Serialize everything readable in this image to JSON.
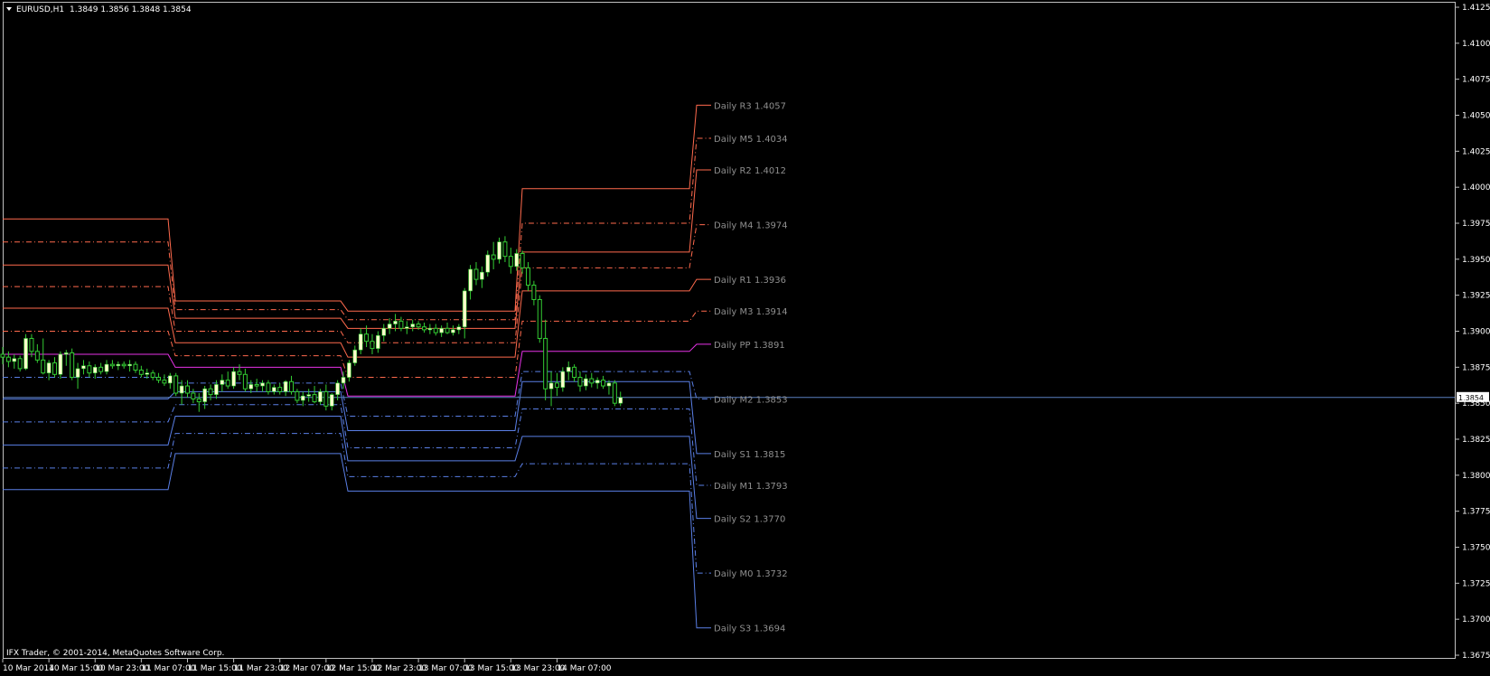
{
  "header": {
    "symbol": "EURUSD,H1",
    "ohlc": "1.3849 1.3856 1.3848 1.3854"
  },
  "footer": {
    "copyright": "IFX Trader, © 2001-2014, MetaQuotes Software Corp."
  },
  "colors": {
    "background": "#000000",
    "frame": "#c0c0c0",
    "resistance": "#ff6a4d",
    "pivot": "#e632e6",
    "support": "#5a7fe6",
    "bull_body": "#ffffcc",
    "wick": "#33cc33",
    "current_line": "#5a7fbf",
    "label_text": "#8f8f8f"
  },
  "chart_data": {
    "type": "candlestick",
    "symbol": "EURUSD",
    "timeframe": "H1",
    "ylim": [
      1.3675,
      1.4125
    ],
    "y_ticks": [
      "1.4125",
      "1.4100",
      "1.4075",
      "1.4050",
      "1.4025",
      "1.4000",
      "1.3975",
      "1.3950",
      "1.3925",
      "1.3900",
      "1.3875",
      "1.3850",
      "1.3825",
      "1.3800",
      "1.3775",
      "1.3750",
      "1.3725",
      "1.3700",
      "1.3675"
    ],
    "x_ticks": [
      "10 Mar 2014",
      "10 Mar 15:00",
      "10 Mar 23:00",
      "11 Mar 07:00",
      "11 Mar 15:00",
      "11 Mar 23:00",
      "12 Mar 07:00",
      "12 Mar 15:00",
      "12 Mar 23:00",
      "13 Mar 07:00",
      "13 Mar 15:00",
      "13 Mar 23:00",
      "14 Mar 07:00"
    ],
    "current_price": "1.3854",
    "day_starts": [
      "11 Mar 00:00",
      "12 Mar 00:00",
      "13 Mar 00:00",
      "14 Mar 00:00"
    ],
    "levels": [
      {
        "name": "R3",
        "role": "resistance",
        "style": "solid",
        "values": [
          1.3978,
          1.3921,
          1.3914,
          1.3999,
          1.4057
        ]
      },
      {
        "name": "M5",
        "role": "resistance",
        "style": "dashdot",
        "values": [
          1.3962,
          1.3915,
          1.3908,
          1.3975,
          1.4034
        ]
      },
      {
        "name": "R2",
        "role": "resistance",
        "style": "solid",
        "values": [
          1.3946,
          1.3909,
          1.3902,
          1.3955,
          1.4012
        ]
      },
      {
        "name": "M4",
        "role": "resistance",
        "style": "dashdot",
        "values": [
          1.3931,
          1.39,
          1.3892,
          1.3944,
          1.3974
        ]
      },
      {
        "name": "R1",
        "role": "resistance",
        "style": "solid",
        "values": [
          1.3916,
          1.3892,
          1.3882,
          1.3928,
          1.3936
        ]
      },
      {
        "name": "M3",
        "role": "resistance",
        "style": "dashdot",
        "values": [
          1.39,
          1.3883,
          1.3868,
          1.3907,
          1.3914
        ]
      },
      {
        "name": "PP",
        "role": "pivot",
        "style": "solid",
        "values": [
          1.3884,
          1.3875,
          1.3855,
          1.3886,
          1.3891
        ]
      },
      {
        "name": "M2",
        "role": "support",
        "style": "dashdot",
        "values": [
          1.3868,
          1.3864,
          1.3841,
          1.3872,
          1.3853
        ]
      },
      {
        "name": "S1",
        "role": "support",
        "style": "solid",
        "values": [
          1.3853,
          1.3858,
          1.3831,
          1.3865,
          1.3815
        ]
      },
      {
        "name": "M1",
        "role": "support",
        "style": "dashdot",
        "values": [
          1.3837,
          1.3849,
          1.3819,
          1.3846,
          1.3793
        ]
      },
      {
        "name": "S2",
        "role": "support",
        "style": "solid",
        "values": [
          1.3821,
          1.3841,
          1.381,
          1.3827,
          1.377
        ]
      },
      {
        "name": "M0",
        "role": "support",
        "style": "dashdot",
        "values": [
          1.3805,
          1.3829,
          1.3799,
          1.3808,
          1.3732
        ]
      },
      {
        "name": "S3",
        "role": "support",
        "style": "solid",
        "values": [
          1.379,
          1.3815,
          1.3789,
          1.3789,
          1.3694
        ]
      }
    ],
    "level_labels": [
      {
        "text": "Daily R3 1.4057",
        "price": 1.4057
      },
      {
        "text": "Daily M5 1.4034",
        "price": 1.4034
      },
      {
        "text": "Daily R2 1.4012",
        "price": 1.4012
      },
      {
        "text": "Daily M4 1.3974",
        "price": 1.3974
      },
      {
        "text": "Daily R1 1.3936",
        "price": 1.3936
      },
      {
        "text": "Daily M3 1.3914",
        "price": 1.3914
      },
      {
        "text": "Daily PP 1.3891",
        "price": 1.3891
      },
      {
        "text": "Daily M2 1.3853",
        "price": 1.3853
      },
      {
        "text": "Daily S1 1.3815",
        "price": 1.3815
      },
      {
        "text": "Daily M1 1.3793",
        "price": 1.3793
      },
      {
        "text": "Daily S2 1.3770",
        "price": 1.377
      },
      {
        "text": "Daily M0 1.3732",
        "price": 1.3732
      },
      {
        "text": "Daily S3 1.3694",
        "price": 1.3694
      }
    ],
    "bar_interval": "1 hour",
    "candles_ohlc": [
      [
        1.3884,
        1.3889,
        1.3877,
        1.3882
      ],
      [
        1.3882,
        1.3886,
        1.3875,
        1.3879
      ],
      [
        1.3879,
        1.3884,
        1.3874,
        1.3881
      ],
      [
        1.3881,
        1.3883,
        1.3872,
        1.3874
      ],
      [
        1.3874,
        1.3898,
        1.3873,
        1.3895
      ],
      [
        1.3895,
        1.3898,
        1.3882,
        1.3886
      ],
      [
        1.3886,
        1.3891,
        1.3878,
        1.388
      ],
      [
        1.388,
        1.3895,
        1.387,
        1.3871
      ],
      [
        1.3871,
        1.388,
        1.3866,
        1.3878
      ],
      [
        1.3878,
        1.3882,
        1.3868,
        1.387
      ],
      [
        1.387,
        1.3886,
        1.3867,
        1.3884
      ],
      [
        1.3884,
        1.3887,
        1.3876,
        1.3885
      ],
      [
        1.3885,
        1.3888,
        1.3866,
        1.3868
      ],
      [
        1.3868,
        1.3878,
        1.386,
        1.3874
      ],
      [
        1.3874,
        1.388,
        1.387,
        1.3876
      ],
      [
        1.3876,
        1.3879,
        1.3868,
        1.3871
      ],
      [
        1.3871,
        1.3877,
        1.3867,
        1.3875
      ],
      [
        1.3875,
        1.3878,
        1.387,
        1.3872
      ],
      [
        1.3872,
        1.388,
        1.387,
        1.3877
      ],
      [
        1.3877,
        1.388,
        1.3874,
        1.3876
      ],
      [
        1.3876,
        1.3879,
        1.3873,
        1.3877
      ],
      [
        1.3877,
        1.3879,
        1.3874,
        1.3876
      ],
      [
        1.3876,
        1.388,
        1.3872,
        1.3877
      ],
      [
        1.3877,
        1.3879,
        1.3871,
        1.3873
      ],
      [
        1.3873,
        1.3876,
        1.3868,
        1.387
      ],
      [
        1.387,
        1.3874,
        1.3867,
        1.3871
      ],
      [
        1.3871,
        1.3873,
        1.3866,
        1.3868
      ],
      [
        1.3868,
        1.3871,
        1.3864,
        1.3866
      ],
      [
        1.3866,
        1.387,
        1.3862,
        1.3864
      ],
      [
        1.3864,
        1.3871,
        1.386,
        1.3869
      ],
      [
        1.3869,
        1.3871,
        1.3855,
        1.3857
      ],
      [
        1.3857,
        1.3866,
        1.3849,
        1.3862
      ],
      [
        1.3862,
        1.3866,
        1.3854,
        1.3857
      ],
      [
        1.3857,
        1.386,
        1.385,
        1.3853
      ],
      [
        1.3853,
        1.3857,
        1.3844,
        1.3851
      ],
      [
        1.3851,
        1.3862,
        1.3846,
        1.386
      ],
      [
        1.386,
        1.3863,
        1.3852,
        1.3856
      ],
      [
        1.3856,
        1.3866,
        1.3853,
        1.3863
      ],
      [
        1.3863,
        1.387,
        1.3858,
        1.3866
      ],
      [
        1.3866,
        1.3872,
        1.386,
        1.3862
      ],
      [
        1.3862,
        1.3875,
        1.386,
        1.3872
      ],
      [
        1.3872,
        1.3877,
        1.3866,
        1.387
      ],
      [
        1.387,
        1.3874,
        1.3858,
        1.386
      ],
      [
        1.386,
        1.3866,
        1.3857,
        1.3863
      ],
      [
        1.3863,
        1.3867,
        1.3858,
        1.3862
      ],
      [
        1.3862,
        1.3866,
        1.3858,
        1.3864
      ],
      [
        1.3864,
        1.3866,
        1.3856,
        1.3858
      ],
      [
        1.3858,
        1.3863,
        1.3856,
        1.3861
      ],
      [
        1.3861,
        1.3864,
        1.3856,
        1.3858
      ],
      [
        1.3858,
        1.3866,
        1.3855,
        1.3865
      ],
      [
        1.3865,
        1.3869,
        1.3856,
        1.3858
      ],
      [
        1.3858,
        1.386,
        1.385,
        1.3852
      ],
      [
        1.3852,
        1.3858,
        1.3848,
        1.3855
      ],
      [
        1.3855,
        1.386,
        1.3851,
        1.3856
      ],
      [
        1.3856,
        1.3862,
        1.385,
        1.3851
      ],
      [
        1.3851,
        1.386,
        1.3849,
        1.3858
      ],
      [
        1.3858,
        1.3863,
        1.3845,
        1.3848
      ],
      [
        1.3848,
        1.3857,
        1.3845,
        1.3856
      ],
      [
        1.3856,
        1.3866,
        1.3852,
        1.3864
      ],
      [
        1.3864,
        1.3872,
        1.386,
        1.3868
      ],
      [
        1.3868,
        1.388,
        1.3865,
        1.3878
      ],
      [
        1.3878,
        1.389,
        1.3876,
        1.3887
      ],
      [
        1.3887,
        1.3902,
        1.3884,
        1.3898
      ],
      [
        1.3898,
        1.3904,
        1.3889,
        1.3893
      ],
      [
        1.3893,
        1.3898,
        1.3884,
        1.3888
      ],
      [
        1.3888,
        1.39,
        1.3885,
        1.3897
      ],
      [
        1.3897,
        1.3905,
        1.3893,
        1.3902
      ],
      [
        1.3902,
        1.3909,
        1.3898,
        1.3905
      ],
      [
        1.3905,
        1.3912,
        1.39,
        1.3907
      ],
      [
        1.3907,
        1.391,
        1.39,
        1.3902
      ],
      [
        1.3902,
        1.3907,
        1.3898,
        1.3903
      ],
      [
        1.3903,
        1.3908,
        1.39,
        1.3905
      ],
      [
        1.3905,
        1.3907,
        1.3901,
        1.3903
      ],
      [
        1.3903,
        1.3906,
        1.3899,
        1.3901
      ],
      [
        1.3901,
        1.3905,
        1.3898,
        1.3902
      ],
      [
        1.3902,
        1.3905,
        1.3897,
        1.3899
      ],
      [
        1.3899,
        1.3904,
        1.3896,
        1.3902
      ],
      [
        1.3902,
        1.3906,
        1.3898,
        1.3899
      ],
      [
        1.3899,
        1.3904,
        1.3897,
        1.3901
      ],
      [
        1.3901,
        1.3905,
        1.3898,
        1.3903
      ],
      [
        1.3903,
        1.393,
        1.3895,
        1.3928
      ],
      [
        1.3928,
        1.3946,
        1.3922,
        1.3943
      ],
      [
        1.3943,
        1.3948,
        1.3932,
        1.3936
      ],
      [
        1.3936,
        1.3945,
        1.393,
        1.3941
      ],
      [
        1.3941,
        1.3956,
        1.3938,
        1.3953
      ],
      [
        1.3953,
        1.3962,
        1.3943,
        1.395
      ],
      [
        1.395,
        1.3965,
        1.3947,
        1.3962
      ],
      [
        1.3962,
        1.3966,
        1.3948,
        1.3952
      ],
      [
        1.3952,
        1.3958,
        1.394,
        1.3945
      ],
      [
        1.3945,
        1.3957,
        1.3942,
        1.3954
      ],
      [
        1.3954,
        1.3956,
        1.394,
        1.3944
      ],
      [
        1.3944,
        1.3948,
        1.3928,
        1.3932
      ],
      [
        1.3932,
        1.3935,
        1.3918,
        1.3922
      ],
      [
        1.3922,
        1.3925,
        1.3892,
        1.3895
      ],
      [
        1.3895,
        1.3908,
        1.3852,
        1.386
      ],
      [
        1.386,
        1.3872,
        1.3848,
        1.3864
      ],
      [
        1.3864,
        1.3871,
        1.3855,
        1.3861
      ],
      [
        1.3861,
        1.3875,
        1.3858,
        1.3872
      ],
      [
        1.3872,
        1.3879,
        1.3866,
        1.3875
      ],
      [
        1.3875,
        1.3877,
        1.3865,
        1.3868
      ],
      [
        1.3868,
        1.3872,
        1.3858,
        1.3862
      ],
      [
        1.3862,
        1.387,
        1.3859,
        1.3867
      ],
      [
        1.3867,
        1.3871,
        1.3861,
        1.3864
      ],
      [
        1.3864,
        1.3868,
        1.386,
        1.3866
      ],
      [
        1.3866,
        1.3869,
        1.386,
        1.3862
      ],
      [
        1.3862,
        1.3866,
        1.3856,
        1.3864
      ],
      [
        1.3864,
        1.3866,
        1.3848,
        1.385
      ],
      [
        1.385,
        1.3858,
        1.3848,
        1.3854
      ]
    ]
  }
}
